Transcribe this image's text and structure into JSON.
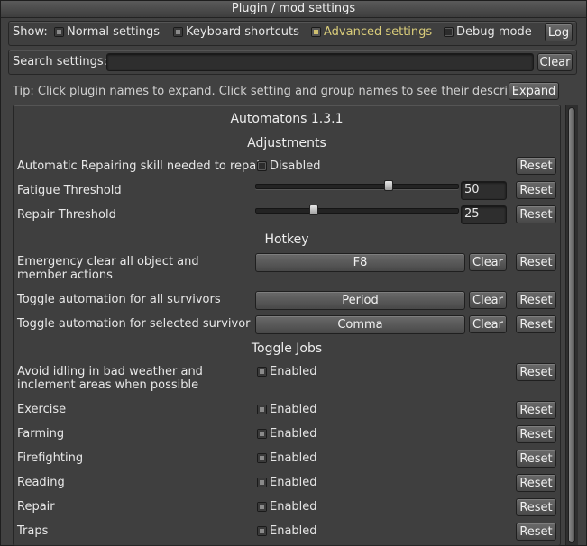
{
  "window": {
    "title": "Plugin / mod settings"
  },
  "show_bar": {
    "label": "Show:",
    "options": [
      {
        "label": "Normal settings",
        "checked": true
      },
      {
        "label": "Keyboard shortcuts",
        "checked": true
      },
      {
        "label": "Advanced settings",
        "checked": true
      },
      {
        "label": "Debug mode",
        "checked": false
      }
    ],
    "log_button": "Log"
  },
  "search": {
    "label": "Search settings:",
    "value": "",
    "clear_button": "Clear"
  },
  "tip": {
    "text": "Tip: Click plugin names to expand. Click setting and group names to see their descriptions.",
    "expand_button": "Expand"
  },
  "plugin": {
    "title": "Automatons 1.3.1",
    "reset_label": "Reset",
    "clear_label": "Clear",
    "groups": {
      "adjustments": {
        "title": "Adjustments",
        "auto_repair": {
          "label": "Automatic Repairing skill needed to repair",
          "toggle": "Disabled",
          "checked": false
        },
        "fatigue": {
          "label": "Fatigue Threshold",
          "value": "50",
          "slider_fraction": 0.66
        },
        "repair": {
          "label": "Repair Threshold",
          "value": "25",
          "slider_fraction": 0.29
        }
      },
      "hotkey": {
        "title": "Hotkey",
        "items": [
          {
            "label": "Emergency clear all object and member actions",
            "key": "F8"
          },
          {
            "label": "Toggle automation for all survivors",
            "key": "Period"
          },
          {
            "label": "Toggle automation for selected survivor",
            "key": "Comma"
          }
        ]
      },
      "toggle_jobs": {
        "title": "Toggle Jobs",
        "items": [
          {
            "label": "Avoid idling in bad weather and inclement areas when possible",
            "toggle": "Enabled"
          },
          {
            "label": "Exercise",
            "toggle": "Enabled"
          },
          {
            "label": "Farming",
            "toggle": "Enabled"
          },
          {
            "label": "Firefighting",
            "toggle": "Enabled"
          },
          {
            "label": "Reading",
            "toggle": "Enabled"
          },
          {
            "label": "Repair",
            "toggle": "Enabled"
          },
          {
            "label": "Traps",
            "toggle": "Enabled"
          }
        ]
      }
    }
  },
  "colors": {
    "accent": "#d9cc7a",
    "background": "#414141"
  }
}
